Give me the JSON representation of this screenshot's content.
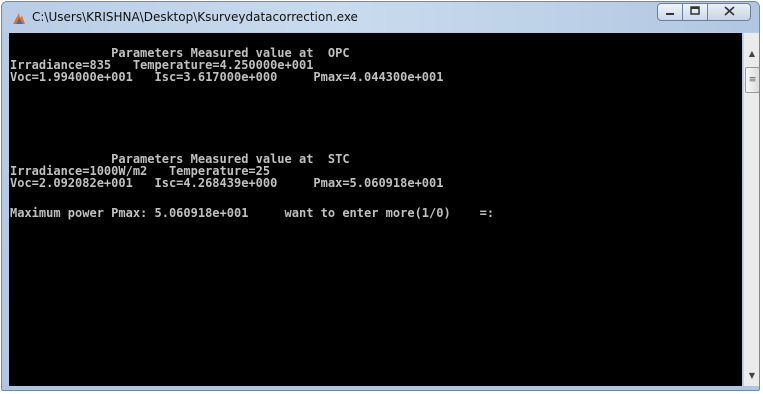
{
  "window": {
    "title": "C:\\Users\\KRISHNA\\Desktop\\Ksurveydatacorrection.exe",
    "app_icon": "app-flame-icon",
    "controls": {
      "minimize": "minimize-icon",
      "maximize": "maximize-icon",
      "close": "close-icon"
    }
  },
  "console": {
    "lines": [
      "              Parameters Measured value at  OPC",
      "Irradiance=835   Temperature=4.250000e+001",
      "Voc=1.994000e+001   Isc=3.617000e+000     Pmax=4.044300e+001",
      "",
      "",
      "",
      "",
      "",
      "              Parameters Measured value at  STC",
      "Irradiance=1000W/m2   Temperature=25",
      "Voc=2.092082e+001   Isc=4.268439e+000     Pmax=5.060918e+001",
      "",
      "Maximum power Pmax: 5.060918e+001     want to enter more(1/0)    =:"
    ]
  },
  "colors": {
    "console_bg": "#000000",
    "console_text": "#c0c0c0",
    "frame": "#b7cbe3"
  }
}
